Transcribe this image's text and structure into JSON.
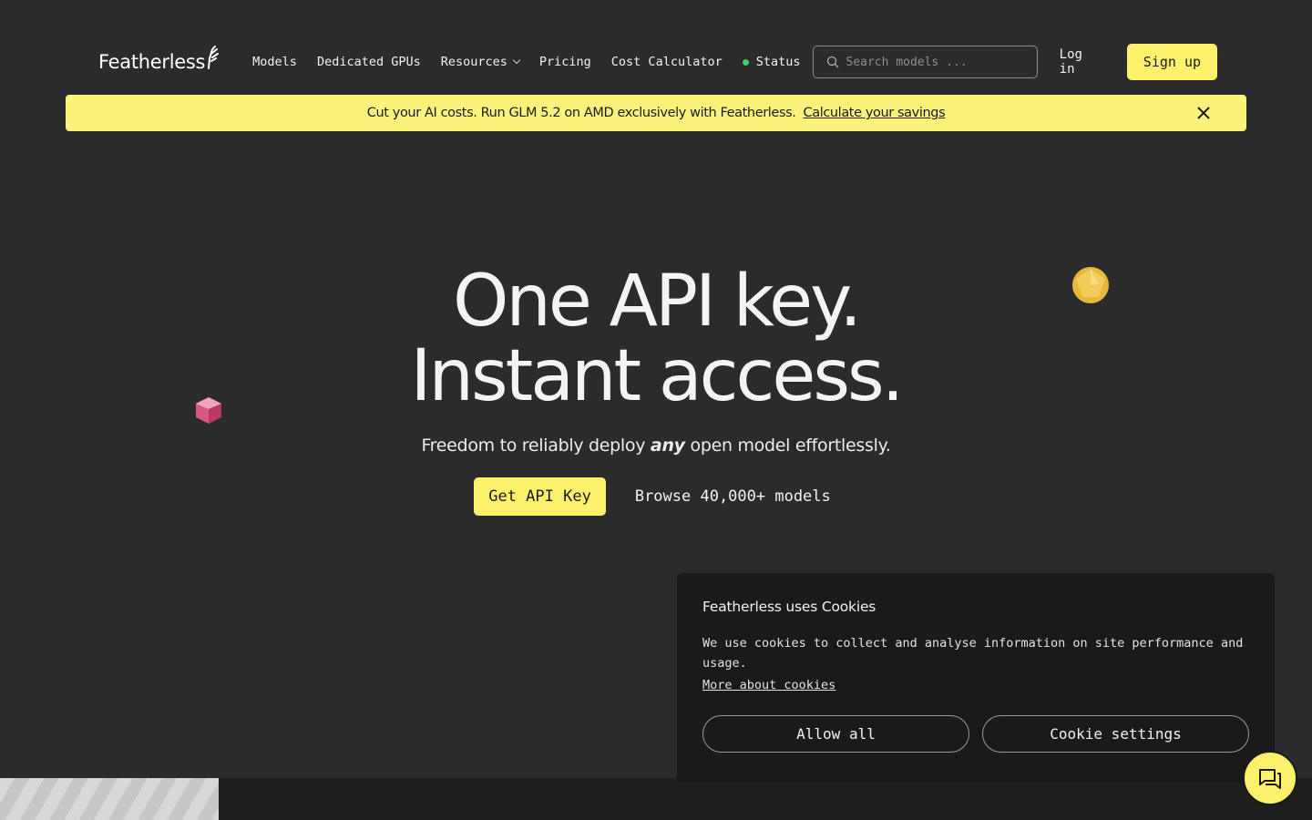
{
  "nav": {
    "logo_text": "Featherless",
    "links": [
      "Models",
      "Dedicated GPUs",
      "Resources",
      "Pricing",
      "Cost Calculator"
    ],
    "status_label": "Status",
    "status_color": "#3ad06a",
    "search_placeholder": "Search models ...",
    "login_label": "Log in",
    "signup_label": "Sign up"
  },
  "banner": {
    "text": "Cut your AI costs. Run GLM 5.2 on AMD exclusively with Featherless.",
    "link_text": "Calculate your savings",
    "color": "#fbf27c"
  },
  "hero": {
    "line1": "One API key.",
    "line2": "Instant access.",
    "sub_before": "Freedom to reliably deploy",
    "sub_emph": "any",
    "sub_after": "open model effortlessly.",
    "cta_primary": "Get API Key",
    "cta_secondary": "Browse 40,000+ models"
  },
  "cookie": {
    "title": "Featherless uses Cookies",
    "body": "We use cookies to collect and analyse information on site performance and usage.",
    "link": "More about cookies",
    "allow_label": "Allow all",
    "settings_label": "Cookie settings"
  },
  "accent_color": "#fdf16b",
  "icons": [
    "feather-logo-icon",
    "search-icon",
    "close-icon",
    "chat-icon",
    "chevron-down-icon"
  ]
}
